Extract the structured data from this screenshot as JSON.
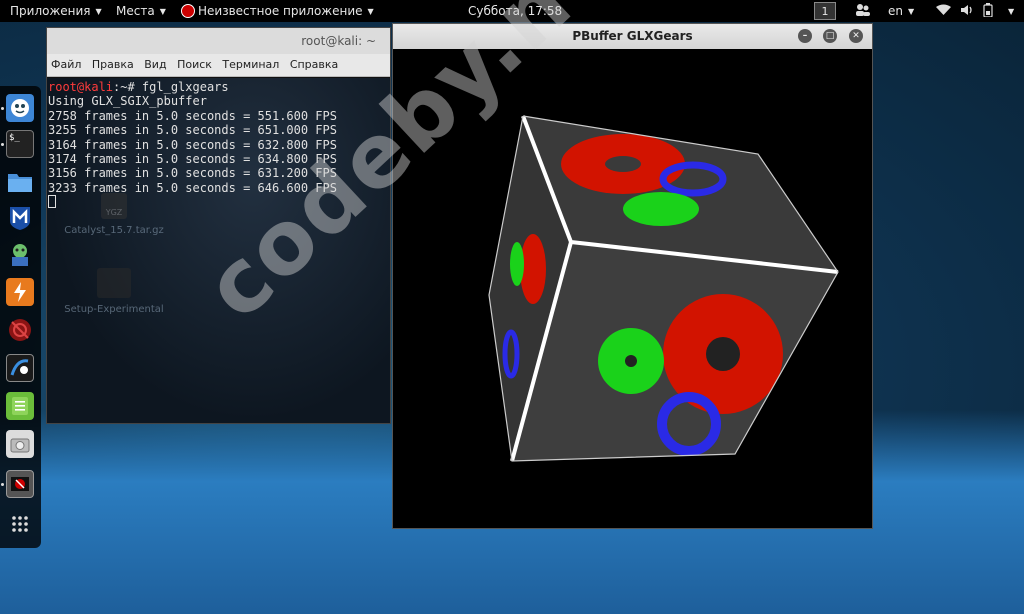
{
  "topbar": {
    "applications": "Приложения",
    "places": "Места",
    "active_app": "Неизвестное приложение",
    "clock": "Суббота, 17:58",
    "workspace": "1",
    "language": "en"
  },
  "desktop": {
    "icons": [
      {
        "label": "Catalyst_15.7.tar.gz",
        "badge": "YGZ"
      },
      {
        "label": "Setup-Experimental"
      }
    ]
  },
  "terminal": {
    "title": "root@kali: ~",
    "menu": [
      "Файл",
      "Правка",
      "Вид",
      "Поиск",
      "Терминал",
      "Справка"
    ],
    "prompt_user": "root@kali",
    "prompt_rest": ":~# fgl_glxgears",
    "lines": [
      "Using GLX_SGIX_pbuffer",
      "2758 frames in 5.0 seconds = 551.600 FPS",
      "3255 frames in 5.0 seconds = 651.000 FPS",
      "3164 frames in 5.0 seconds = 632.800 FPS",
      "3174 frames in 5.0 seconds = 634.800 FPS",
      "3156 frames in 5.0 seconds = 631.200 FPS",
      "3233 frames in 5.0 seconds = 646.600 FPS"
    ]
  },
  "gears_window": {
    "title": "PBuffer GLXGears"
  },
  "watermark": "codeby.net",
  "colors": {
    "gear_red": "#d21300",
    "gear_green": "#1ad21a",
    "gear_blue": "#2a2ae6",
    "prompt_red": "#ff3b3b"
  }
}
